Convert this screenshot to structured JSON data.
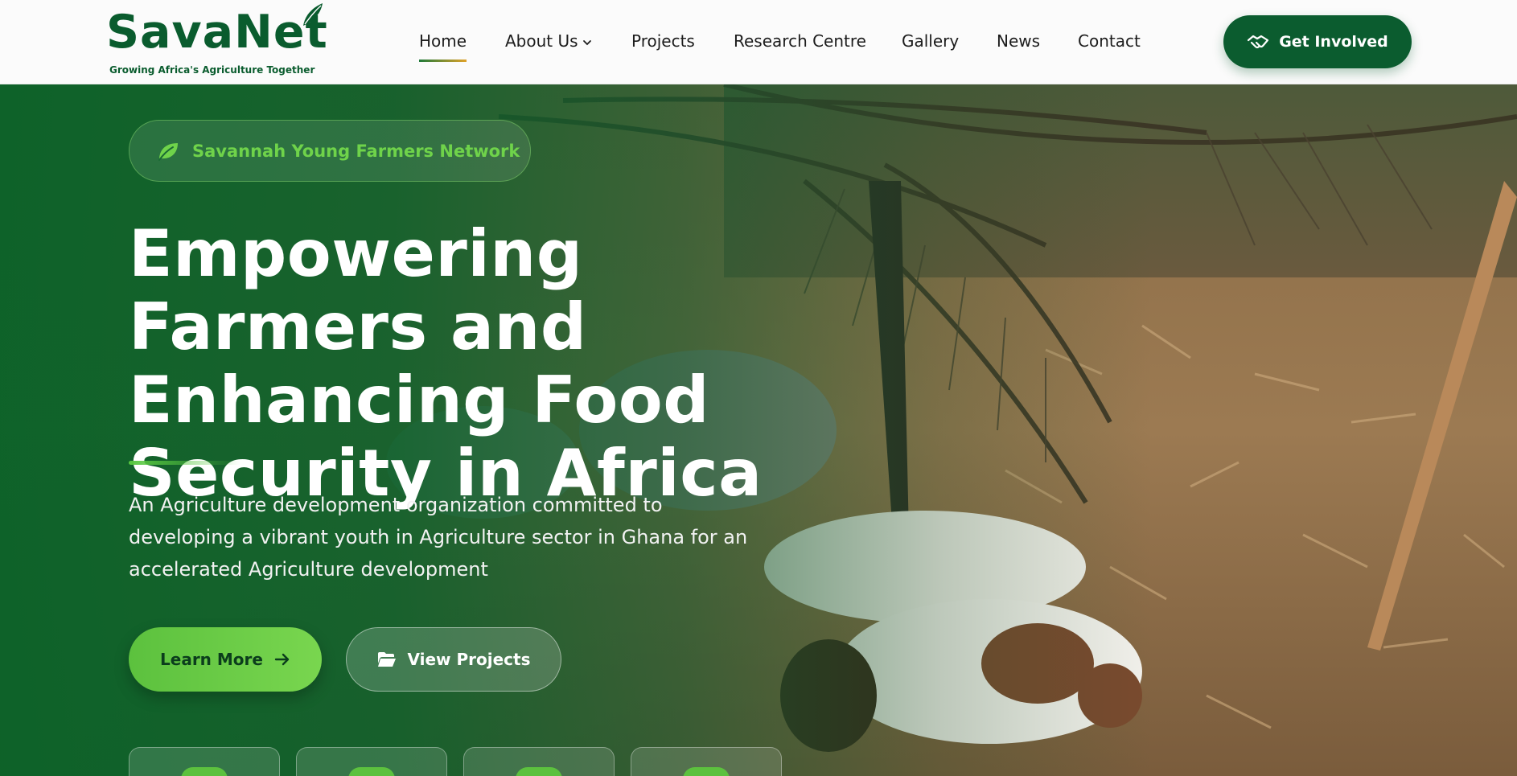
{
  "brand": {
    "name": "SavaNet",
    "tagline": "Growing Africa's Agriculture Together",
    "color": "#0a5c2e"
  },
  "nav": {
    "items": [
      {
        "label": "Home",
        "active": true
      },
      {
        "label": "About Us",
        "dropdown": true
      },
      {
        "label": "Projects"
      },
      {
        "label": "Research Centre"
      },
      {
        "label": "Gallery"
      },
      {
        "label": "News"
      },
      {
        "label": "Contact"
      }
    ],
    "cta_label": "Get Involved",
    "cta_icon": "handshake-icon"
  },
  "hero": {
    "badge": "Savannah Young Farmers Network",
    "badge_icon": "leaf-icon",
    "title": "Empowering Farmers and Enhancing Food Security in Africa",
    "description": "An Agriculture development organization committed to developing a vibrant youth in Agriculture sector in Ghana for an accelerated Agriculture development",
    "primary_button": "Learn More",
    "primary_icon": "arrow-right-icon",
    "secondary_button": "View Projects",
    "secondary_icon": "folder-open-icon",
    "accent_color": "#5cc13e"
  },
  "stat_cards": [
    {},
    {},
    {},
    {}
  ]
}
